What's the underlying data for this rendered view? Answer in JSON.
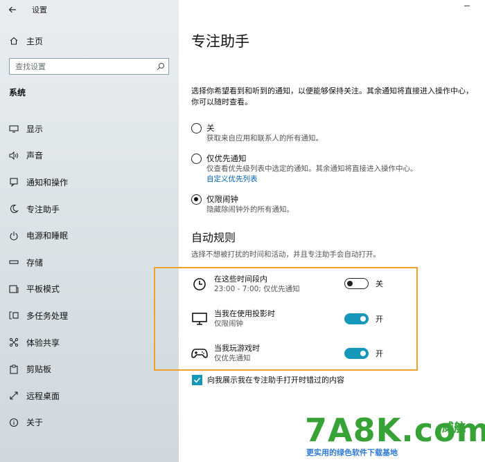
{
  "window": {
    "title": "设置"
  },
  "sidebar": {
    "home_label": "主页",
    "search_placeholder": "查找设置",
    "section": "系统",
    "items": [
      {
        "label": "显示",
        "icon": "monitor-icon"
      },
      {
        "label": "声音",
        "icon": "speaker-icon"
      },
      {
        "label": "通知和操作",
        "icon": "notification-icon"
      },
      {
        "label": "专注助手",
        "icon": "moon-icon",
        "active": true
      },
      {
        "label": "电源和睡眠",
        "icon": "power-icon"
      },
      {
        "label": "存储",
        "icon": "storage-icon"
      },
      {
        "label": "平板模式",
        "icon": "tablet-icon"
      },
      {
        "label": "多任务处理",
        "icon": "multitask-icon"
      },
      {
        "label": "体验共享",
        "icon": "share-icon"
      },
      {
        "label": "剪贴板",
        "icon": "clipboard-icon"
      },
      {
        "label": "远程桌面",
        "icon": "remote-icon"
      },
      {
        "label": "关于",
        "icon": "info-icon"
      }
    ]
  },
  "main": {
    "title": "专注助手",
    "description": "选择你希望看到和听到的通知，以便能够保持关注。其余通知将直接进入操作中心，你可以随时查看。",
    "options": [
      {
        "label": "关",
        "desc": "获取来自应用和联系人的所有通知。",
        "checked": false
      },
      {
        "label": "仅优先通知",
        "desc": "仅查看优先级列表中选定的通知。其余通知将直接进入操作中心。",
        "link": "自定义优先列表",
        "checked": false
      },
      {
        "label": "仅限闹钟",
        "desc": "隐藏除闹钟外的所有通知。",
        "checked": true
      }
    ],
    "auto_rules": {
      "title": "自动规则",
      "desc": "选择不想被打扰的时间和活动，并且专注助手会自动打开。",
      "rules": [
        {
          "title": "在这些时间段内",
          "sub": "23:00 - 7:00; 仅优先通知",
          "state": "关",
          "on": false,
          "icon": "clock-icon"
        },
        {
          "title": "当我在使用投影时",
          "sub": "仅限闹钟",
          "state": "开",
          "on": true,
          "icon": "display-icon"
        },
        {
          "title": "当我玩游戏时",
          "sub": "仅优先通知",
          "state": "开",
          "on": true,
          "icon": "gamepad-icon"
        }
      ]
    },
    "checkbox_label": "向我展示我在专注助手打开时错过的内容"
  },
  "watermark": {
    "main": "7A8K.com",
    "side": "威航",
    "tag": "更实用的绿色软件下载基地"
  },
  "colors": {
    "accent": "#1597b9",
    "link": "#0063b1",
    "highlight": "#f0a12c"
  }
}
